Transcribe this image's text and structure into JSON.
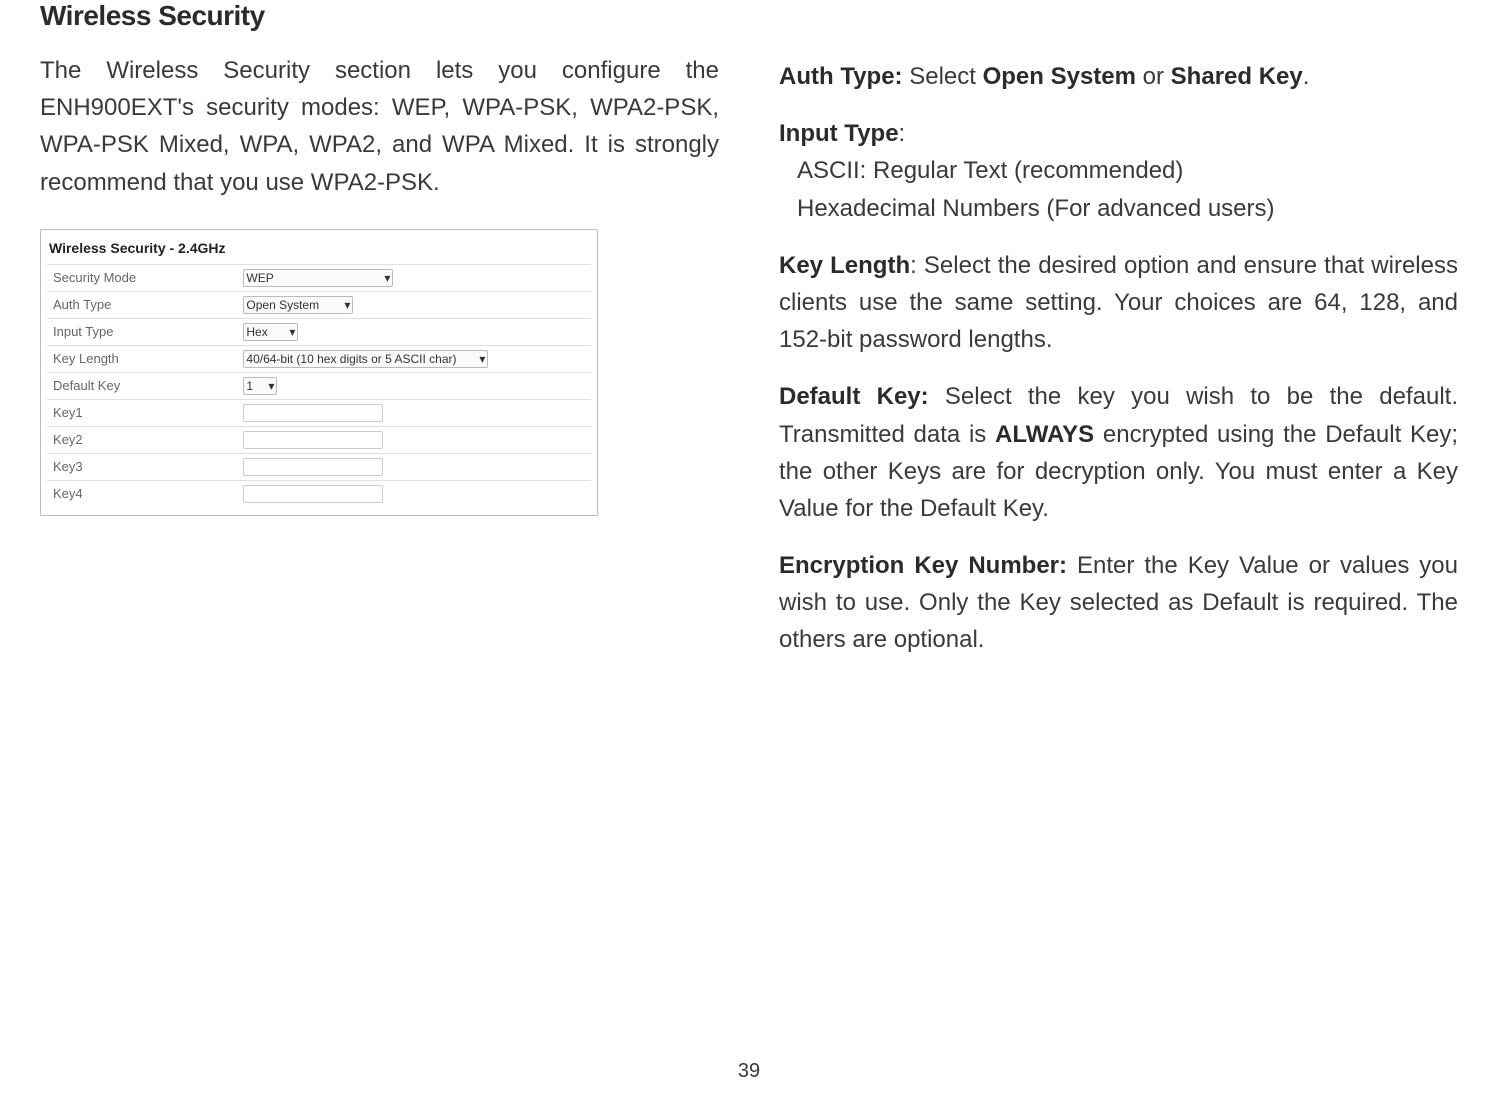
{
  "left": {
    "heading": "Wireless Security",
    "intro": "The Wireless Security section lets you configure the ENH900EXT's security modes: WEP, WPA-PSK, WPA2-PSK, WPA-PSK Mixed, WPA, WPA2, and WPA Mixed. It is strongly recommend that you use WPA2-PSK."
  },
  "panel": {
    "title": "Wireless Security - 2.4GHz",
    "rows": {
      "security_mode_label": "Security Mode",
      "security_mode_value": "WEP",
      "auth_type_label": "Auth Type",
      "auth_type_value": "Open System",
      "input_type_label": "Input Type",
      "input_type_value": "Hex",
      "key_length_label": "Key Length",
      "key_length_value": "40/64-bit (10 hex digits or 5 ASCII char)",
      "default_key_label": "Default Key",
      "default_key_value": "1",
      "key1_label": "Key1",
      "key2_label": "Key2",
      "key3_label": "Key3",
      "key4_label": "Key4"
    }
  },
  "right": {
    "auth_type_strong": "Auth Type: ",
    "auth_type_text1": "Select ",
    "auth_type_open": "Open System",
    "auth_type_or": " or ",
    "auth_type_shared": "Shared Key",
    "auth_type_period": ".",
    "input_type_strong": "Input Type",
    "input_type_colon": ":",
    "input_type_line1": "ASCII: Regular Text (recommended)",
    "input_type_line2": "Hexadecimal Numbers (For advanced users)",
    "key_length_strong": "Key Length",
    "key_length_text": ": Select the desired option and ensure that wireless clients use the same setting. Your choices are 64, 128, and 152-bit password lengths.",
    "default_key_strong": "Default Key: ",
    "default_key_text1": "Select the key you wish to be the default. Transmitted data is ",
    "default_key_always": "ALWAYS",
    "default_key_text2": " encrypted using the Default Key; the other Keys are for decryption only. You must enter a Key Value for the Default Key.",
    "enc_key_strong": "Encryption Key Number: ",
    "enc_key_text": "Enter the Key Value or values you wish to use. Only the Key selected as Default is required. The others are optional."
  },
  "page_number": "39"
}
